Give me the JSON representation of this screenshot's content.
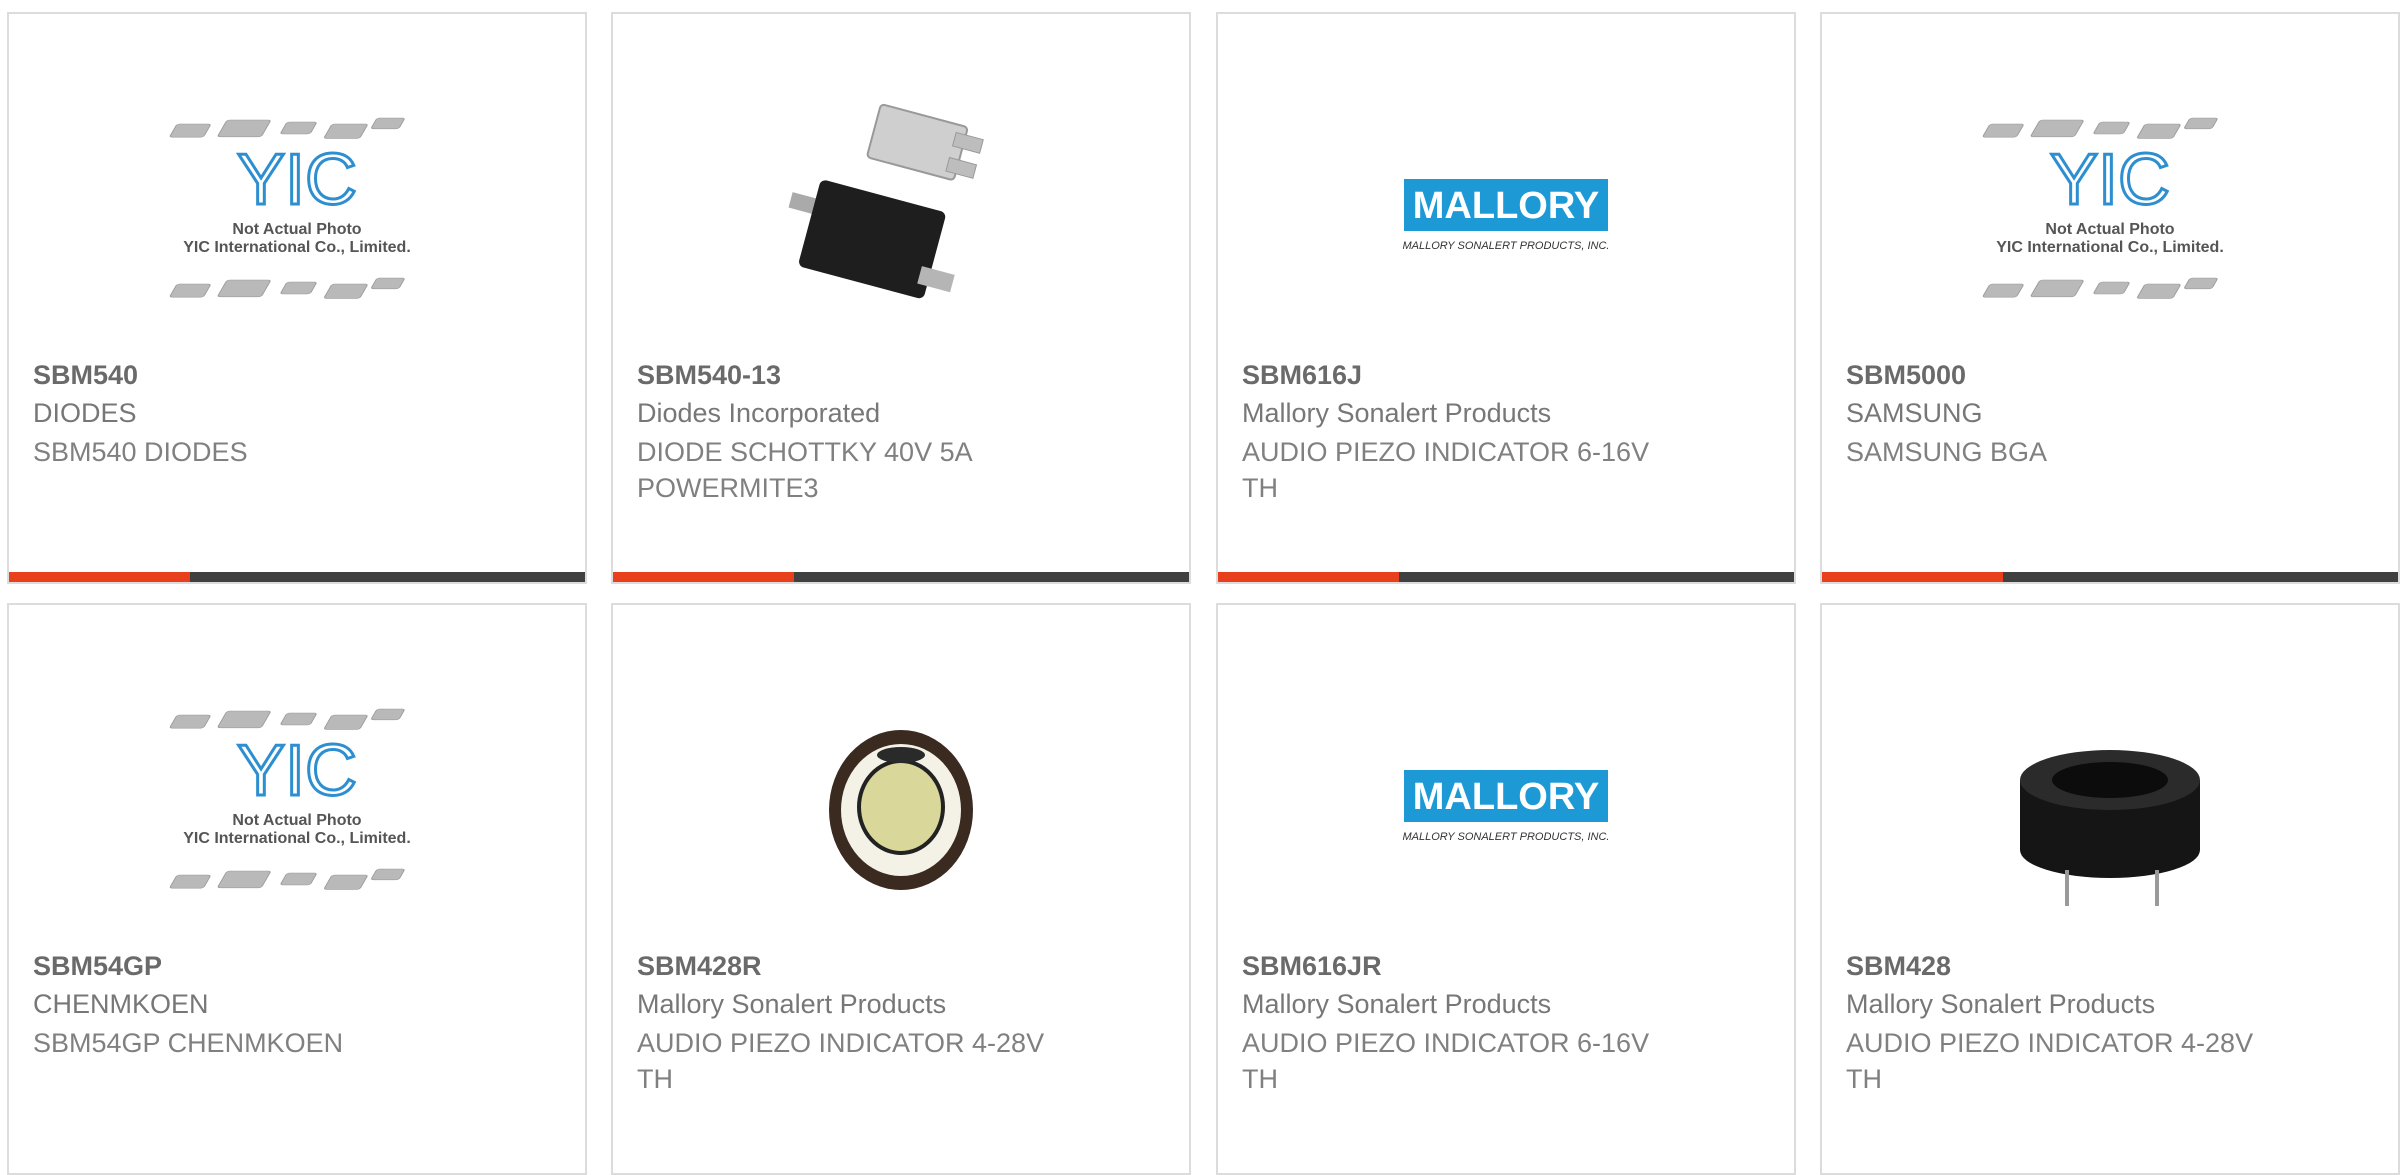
{
  "products": [
    {
      "part": "SBM540",
      "manufacturer": "DIODES",
      "description": "SBM540 DIODES",
      "image": {
        "type": "placeholder",
        "icon": "yic-placeholder-icon",
        "line1": "Not Actual Photo",
        "line2": "YIC International Co., Limited.",
        "brand": "YIC"
      }
    },
    {
      "part": "SBM540-13",
      "manufacturer": "Diodes Incorporated",
      "description": "DIODE SCHOTTKY 40V 5A POWERMITE3",
      "image": {
        "type": "chip",
        "icon": "powermite-chip-icon"
      }
    },
    {
      "part": "SBM616J",
      "manufacturer": "Mallory Sonalert Products",
      "description": "AUDIO PIEZO INDICATOR 6-16V TH",
      "image": {
        "type": "mallory",
        "icon": "mallory-logo-icon",
        "brand": "MALLORY",
        "tagline": "MALLORY SONALERT PRODUCTS, INC."
      }
    },
    {
      "part": "SBM5000",
      "manufacturer": "SAMSUNG",
      "description": "SAMSUNG BGA",
      "image": {
        "type": "placeholder",
        "icon": "yic-placeholder-icon",
        "line1": "Not Actual Photo",
        "line2": "YIC International Co., Limited.",
        "brand": "YIC"
      }
    },
    {
      "part": "SBM54GP",
      "manufacturer": "CHENMKOEN",
      "description": "SBM54GP CHENMKOEN",
      "image": {
        "type": "placeholder",
        "icon": "yic-placeholder-icon",
        "line1": "Not Actual Photo",
        "line2": "YIC International Co., Limited.",
        "brand": "YIC"
      }
    },
    {
      "part": "SBM428R",
      "manufacturer": "Mallory Sonalert Products",
      "description": "AUDIO PIEZO INDICATOR 4-28V TH",
      "image": {
        "type": "buzzer-front",
        "icon": "piezo-buzzer-icon"
      }
    },
    {
      "part": "SBM616JR",
      "manufacturer": "Mallory Sonalert Products",
      "description": "AUDIO PIEZO INDICATOR 6-16V TH",
      "image": {
        "type": "mallory",
        "icon": "mallory-logo-icon",
        "brand": "MALLORY",
        "tagline": "MALLORY SONALERT PRODUCTS, INC."
      }
    },
    {
      "part": "SBM428",
      "manufacturer": "Mallory Sonalert Products",
      "description": "AUDIO PIEZO INDICATOR 4-28V TH",
      "image": {
        "type": "buzzer-side",
        "icon": "piezo-buzzer-side-icon"
      }
    }
  ],
  "colors": {
    "accent": "#e8401c",
    "bar": "#404040",
    "mallory_blue": "#1d9ad6",
    "yic_blue": "#2e8fd0"
  }
}
